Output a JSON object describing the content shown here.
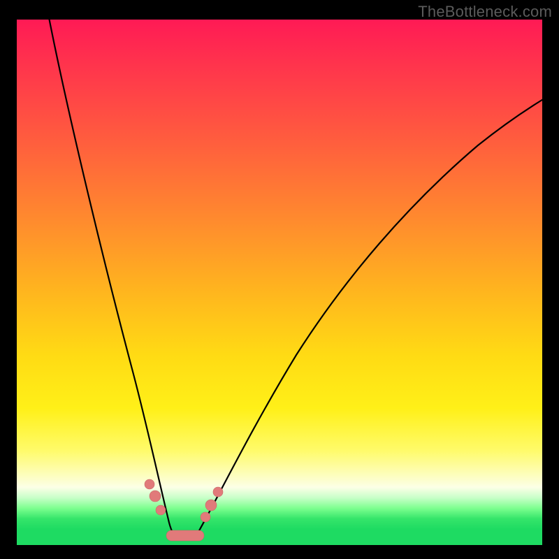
{
  "watermark": "TheBottleneck.com",
  "chart_data": {
    "type": "line",
    "title": "",
    "xlabel": "",
    "ylabel": "",
    "xlim": [
      0,
      100
    ],
    "ylim": [
      0,
      100
    ],
    "background_gradient": {
      "stops": [
        {
          "pos": 0,
          "color": "#ff1a55"
        },
        {
          "pos": 22,
          "color": "#ff5a3f"
        },
        {
          "pos": 52,
          "color": "#ffb61e"
        },
        {
          "pos": 74,
          "color": "#fff018"
        },
        {
          "pos": 89,
          "color": "#fcffe6"
        },
        {
          "pos": 95,
          "color": "#35e56a"
        },
        {
          "pos": 100,
          "color": "#1edb62"
        }
      ]
    },
    "series": [
      {
        "name": "left-branch",
        "x": [
          6,
          8,
          10,
          12,
          14,
          16,
          18,
          20,
          22,
          24,
          26,
          27.5,
          29
        ],
        "y": [
          100,
          90,
          79,
          68,
          57,
          47,
          37,
          28,
          20,
          13,
          7,
          4,
          2
        ]
      },
      {
        "name": "right-branch",
        "x": [
          34,
          36,
          40,
          45,
          50,
          56,
          62,
          70,
          78,
          86,
          94,
          100
        ],
        "y": [
          2,
          5,
          12,
          20,
          28,
          36,
          44,
          53,
          61,
          69,
          76,
          81
        ]
      }
    ],
    "trough": {
      "x_start": 29,
      "x_end": 34,
      "y": 2
    },
    "markers": [
      {
        "x": 25.0,
        "y": 10,
        "r": 6
      },
      {
        "x": 26.3,
        "y": 7,
        "r": 7
      },
      {
        "x": 27.2,
        "y": 5,
        "r": 6
      },
      {
        "x": 35.3,
        "y": 4,
        "r": 6
      },
      {
        "x": 36.5,
        "y": 6,
        "r": 7
      },
      {
        "x": 37.8,
        "y": 8,
        "r": 6
      }
    ],
    "colors": {
      "curve": "#000000",
      "marker_fill": "#e17a7a",
      "marker_stroke": "#c86565"
    }
  }
}
